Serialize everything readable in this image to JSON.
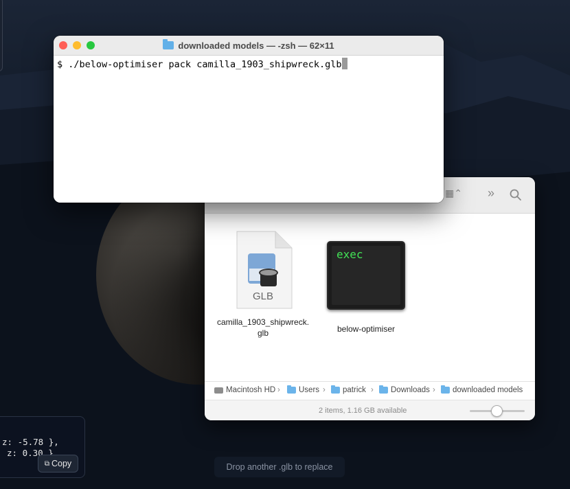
{
  "terminal": {
    "title": "downloaded models — -zsh — 62×11",
    "command": "$ ./below-optimiser pack camilla_1903_shipwreck.glb",
    "traffic_lights": {
      "close": "#ff5f57",
      "minimize": "#febc2e",
      "zoom": "#28c840"
    }
  },
  "finder": {
    "files": [
      {
        "name": "camilla_1903_shipwreck.\nglb",
        "icon": "glb-document-icon",
        "badge": "GLB"
      },
      {
        "name": "below-optimiser",
        "icon": "exec-terminal-icon",
        "badge": "exec"
      }
    ],
    "pathbar": [
      {
        "label": "Macintosh HD",
        "icon": "hard-drive-icon"
      },
      {
        "label": "Users",
        "icon": "folder-icon"
      },
      {
        "label": "patrick",
        "icon": "folder-icon"
      },
      {
        "label": "Downloads",
        "icon": "folder-icon"
      },
      {
        "label": "downloaded models",
        "icon": "folder-icon"
      }
    ],
    "status": "2 items, 1.16 GB available"
  },
  "coords_panel": {
    "line1": "z: -5.78 },",
    "line2": "z: 0.30 }",
    "copy_label": "Copy"
  },
  "drop_hint": "Drop another .glb to replace"
}
